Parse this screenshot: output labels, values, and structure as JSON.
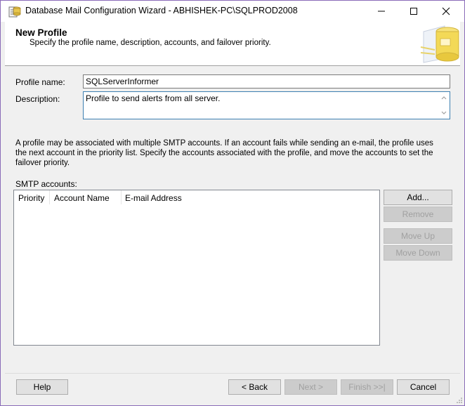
{
  "window": {
    "title": "Database Mail Configuration Wizard - ABHISHEK-PC\\SQLPROD2008",
    "minimize": "—",
    "maximize": "☐",
    "close": "✕"
  },
  "header": {
    "title": "New Profile",
    "subtitle": "Specify the profile name, description, accounts, and failover priority."
  },
  "form": {
    "profile_name_label": "Profile name:",
    "profile_name_value": "SQLServerInformer",
    "description_label": "Description:",
    "description_value": "Profile to send alerts from all server."
  },
  "info_text": "A profile may be associated with multiple SMTP accounts. If an account fails while sending an e-mail, the profile uses the next account in the priority list. Specify the accounts associated with the profile, and move the accounts to set the failover priority.",
  "smtp": {
    "label": "SMTP accounts:",
    "columns": [
      "Priority",
      "Account Name",
      "E-mail Address"
    ],
    "rows": [],
    "buttons": {
      "add": "Add...",
      "remove": "Remove",
      "move_up": "Move Up",
      "move_down": "Move Down"
    }
  },
  "footer": {
    "help": "Help",
    "back": "< Back",
    "next": "Next >",
    "finish": "Finish >>|",
    "cancel": "Cancel"
  },
  "colors": {
    "window_border": "#8a6bb8",
    "focus_border": "#3c7fb1",
    "disabled_text": "#a0a0a0"
  }
}
